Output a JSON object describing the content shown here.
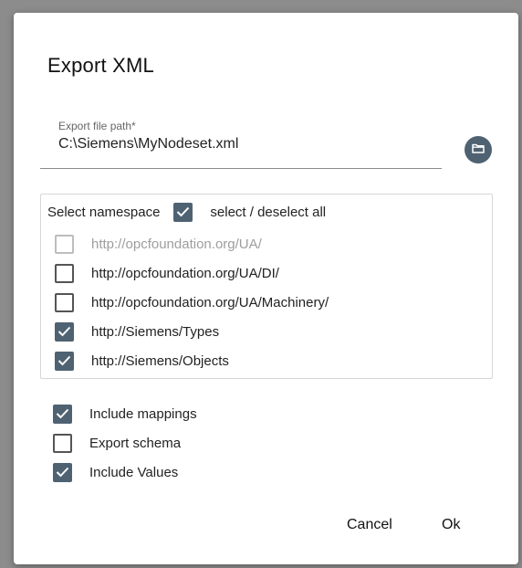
{
  "dialog": {
    "title": "Export XML"
  },
  "export_path": {
    "label": "Export file path*",
    "value": "C:\\Siemens\\MyNodeset.xml"
  },
  "namespaces": {
    "header_label": "Select namespace",
    "select_all_label": "select / deselect all",
    "select_all_checked": true,
    "items": [
      {
        "label": "http://opcfoundation.org/UA/",
        "checked": false,
        "disabled": true
      },
      {
        "label": "http://opcfoundation.org/UA/DI/",
        "checked": false,
        "disabled": false
      },
      {
        "label": "http://opcfoundation.org/UA/Machinery/",
        "checked": false,
        "disabled": false
      },
      {
        "label": "http://Siemens/Types",
        "checked": true,
        "disabled": false
      },
      {
        "label": "http://Siemens/Objects",
        "checked": true,
        "disabled": false
      }
    ]
  },
  "options": [
    {
      "label": "Include mappings",
      "checked": true
    },
    {
      "label": "Export schema",
      "checked": false
    },
    {
      "label": "Include Values",
      "checked": true
    }
  ],
  "buttons": {
    "cancel": "Cancel",
    "ok": "Ok"
  },
  "colors": {
    "accent": "#4e6272",
    "backdrop": "#8c8c8c"
  }
}
